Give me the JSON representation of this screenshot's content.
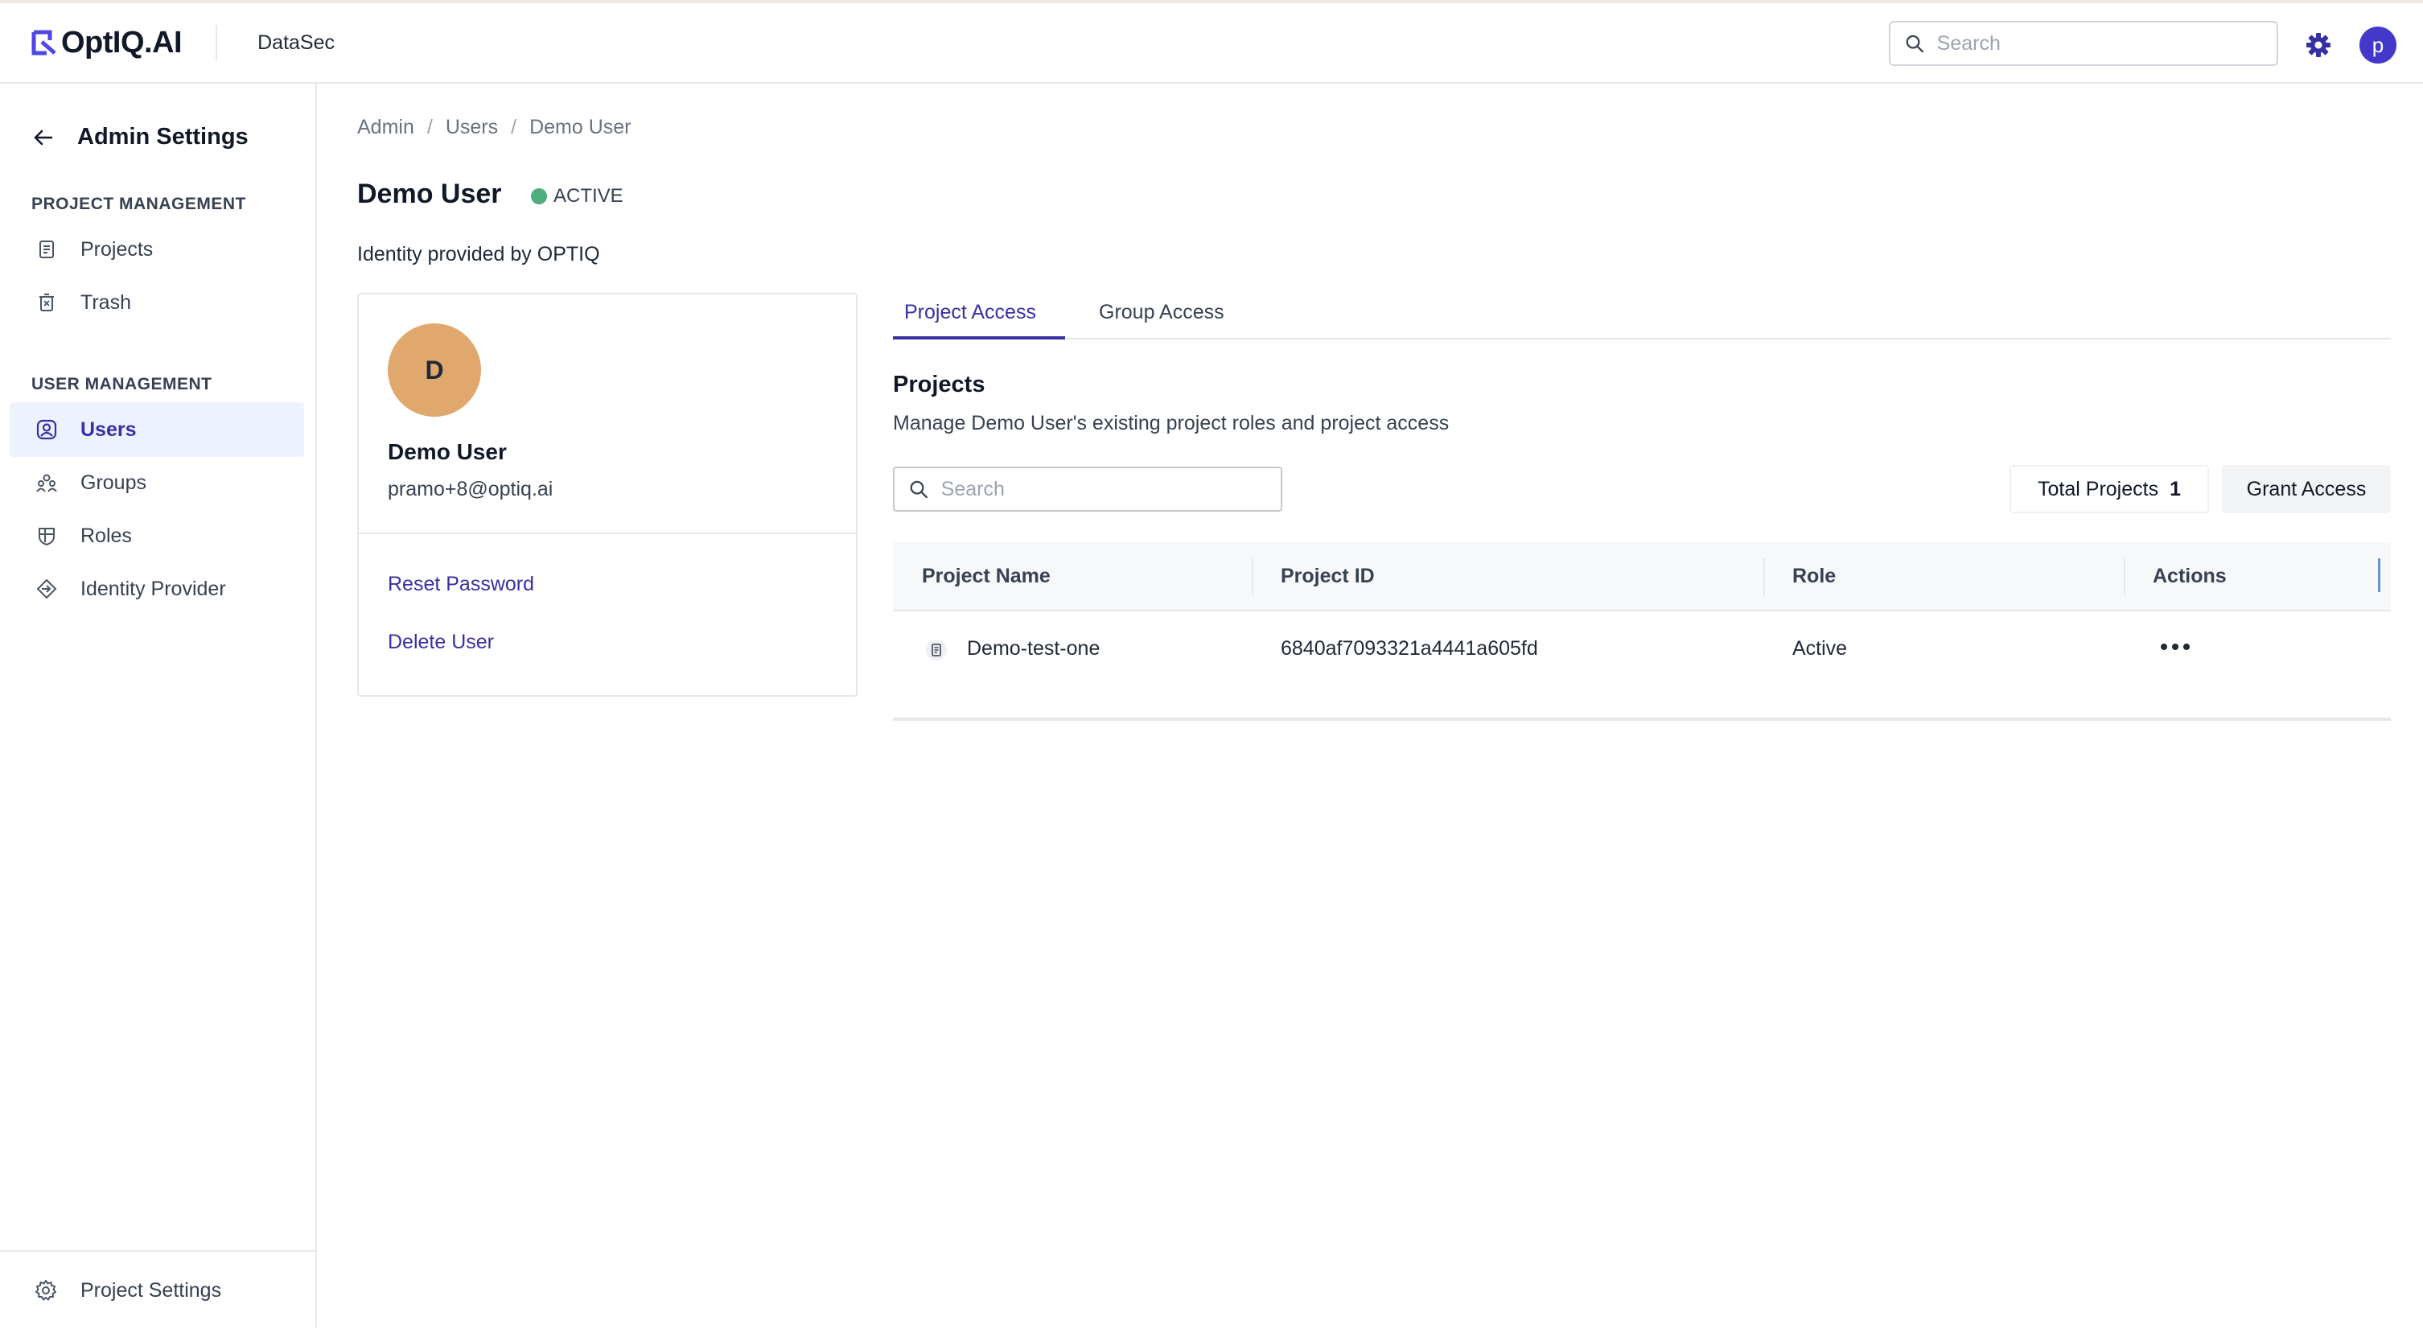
{
  "app": {
    "logo_text": "OptIQ.AI",
    "workspace": "DataSec",
    "search_placeholder": "Search",
    "avatar_initial": "p",
    "accent_color": "#3730a3"
  },
  "sidebar": {
    "title": "Admin Settings",
    "project_section": "PROJECT MANAGEMENT",
    "project_items": [
      {
        "label": "Projects",
        "icon": "document-icon"
      },
      {
        "label": "Trash",
        "icon": "trash-icon"
      }
    ],
    "user_section": "USER MANAGEMENT",
    "user_items": [
      {
        "label": "Users",
        "icon": "user-icon",
        "active": true
      },
      {
        "label": "Groups",
        "icon": "groups-icon"
      },
      {
        "label": "Roles",
        "icon": "roles-icon"
      },
      {
        "label": "Identity Provider",
        "icon": "login-icon"
      }
    ],
    "footer_label": "Project Settings"
  },
  "breadcrumb": [
    "Admin",
    "Users",
    "Demo User"
  ],
  "user": {
    "name": "Demo User",
    "status": "ACTIVE",
    "status_color": "#4caf7d",
    "identity": "Identity provided by OPTIQ",
    "initial": "D",
    "email": "pramo+8@optiq.ai",
    "reset_password": "Reset Password",
    "delete_user": "Delete User"
  },
  "tabs": [
    {
      "label": "Project Access",
      "active": true
    },
    {
      "label": "Group Access",
      "active": false
    }
  ],
  "projects": {
    "title": "Projects",
    "description": "Manage Demo User's existing project roles and project access",
    "search_placeholder": "Search",
    "total_label": "Total Projects",
    "total_count": "1",
    "grant_label": "Grant Access",
    "columns": [
      "Project Name",
      "Project ID",
      "Role",
      "Actions"
    ],
    "rows": [
      {
        "name": "Demo-test-one",
        "id": "6840af7093321a4441a605fd",
        "role": "Active"
      }
    ]
  }
}
